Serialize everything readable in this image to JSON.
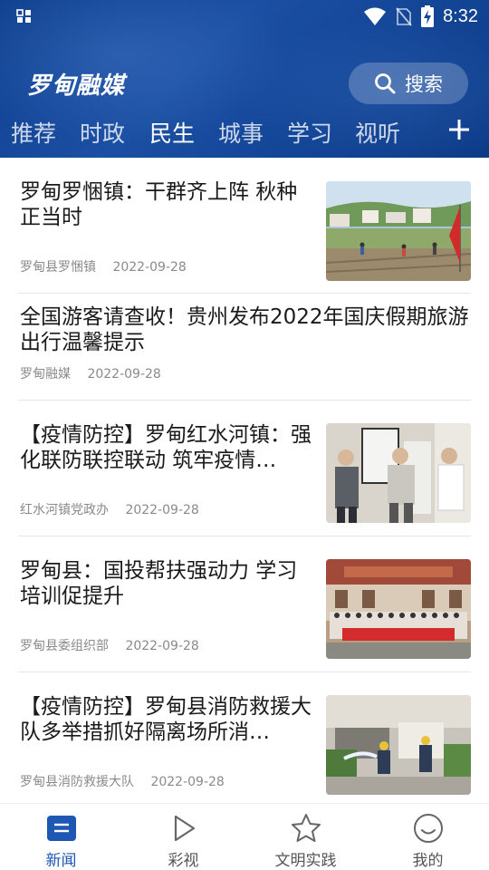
{
  "status_bar": {
    "time": "8:32",
    "icons": [
      "gallery-icon",
      "wifi-icon",
      "no-sim-icon",
      "battery-charging-icon"
    ]
  },
  "header": {
    "logo_text": "罗甸融媒",
    "search_label": "搜索",
    "tabs": [
      {
        "label": "推荐",
        "active": false
      },
      {
        "label": "时政",
        "active": false
      },
      {
        "label": "民生",
        "active": true
      },
      {
        "label": "城事",
        "active": false
      },
      {
        "label": "学习",
        "active": false
      },
      {
        "label": "视听",
        "active": false
      }
    ],
    "add_icon": "plus-icon"
  },
  "news": [
    {
      "title": "罗甸罗悃镇：干群齐上阵 秋种正当时",
      "source": "罗甸县罗悃镇",
      "date": "2022-09-28",
      "thumbnail": "field-planting-photo"
    },
    {
      "title": "全国游客请查收！贵州发布2022年国庆假期旅游出行温馨提示",
      "source": "罗甸融媒",
      "date": "2022-09-28",
      "thumbnail": null
    },
    {
      "title": "【疫情防控】罗甸红水河镇：强化联防联控联动 筑牢疫情…",
      "source": "红水河镇党政办",
      "date": "2022-09-28",
      "thumbnail": "officials-meeting-photo"
    },
    {
      "title": "罗甸县：国投帮扶强动力 学习培训促提升",
      "source": "罗甸县委组织部",
      "date": "2022-09-28",
      "thumbnail": "group-photo-banner"
    },
    {
      "title": "【疫情防控】罗甸县消防救援大队多举措抓好隔离场所消…",
      "source": "罗甸县消防救援大队",
      "date": "2022-09-28",
      "thumbnail": "firefighters-drill-photo"
    }
  ],
  "bottom_nav": [
    {
      "label": "新闻",
      "icon": "news-icon",
      "active": true
    },
    {
      "label": "彩视",
      "icon": "play-icon",
      "active": false
    },
    {
      "label": "文明实践",
      "icon": "star-icon",
      "active": false
    },
    {
      "label": "我的",
      "icon": "smiley-icon",
      "active": false
    }
  ],
  "colors": {
    "header_blue": "#134596",
    "accent_blue": "#1f57b4",
    "meta_gray": "#8a8a8a"
  }
}
